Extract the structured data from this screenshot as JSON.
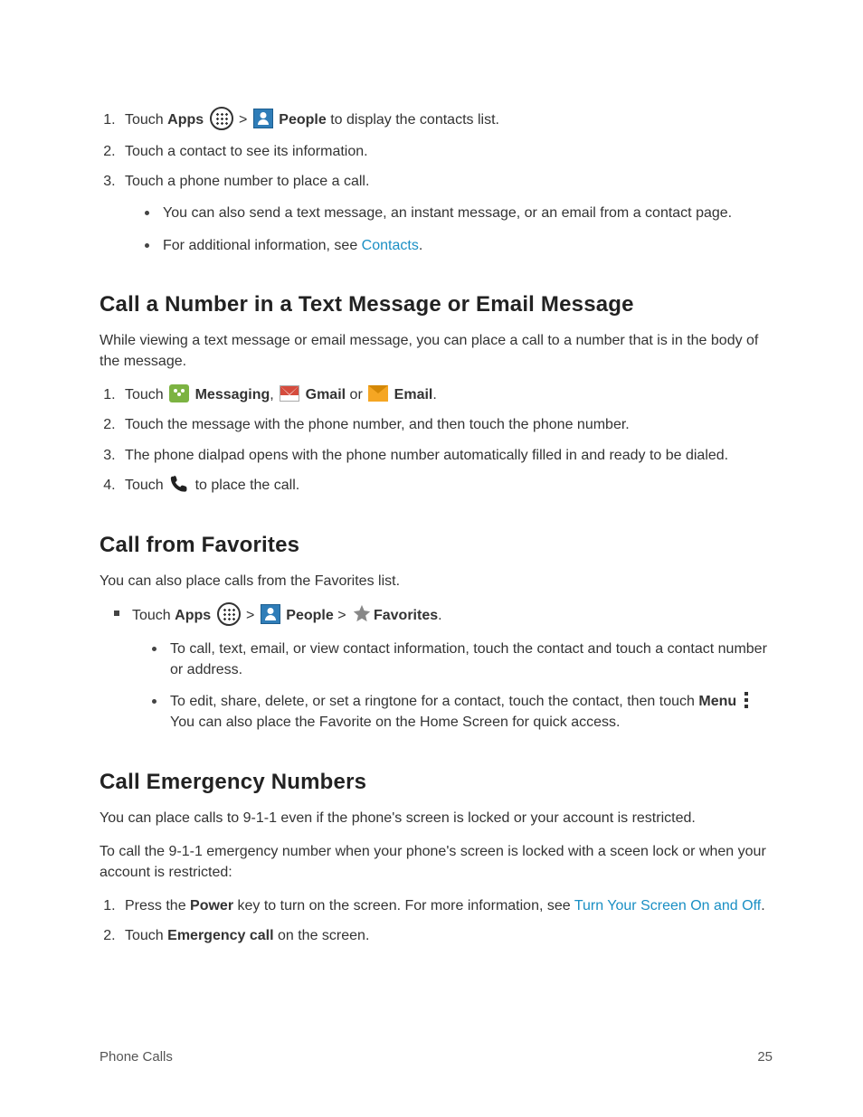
{
  "intro": {
    "step1_pre": "Touch ",
    "step1_apps": "Apps",
    "gt": " > ",
    "step1_people": "People",
    "step1_post": " to display the contacts list.",
    "step2": "Touch a contact to see its information.",
    "step3": "Touch a phone number to place a call.",
    "step3_sub1": "You can also send a text message, an instant message, or an email from a contact page.",
    "step3_sub2_pre": "For additional information, see ",
    "step3_sub2_link": "Contacts",
    "step3_sub2_post": "."
  },
  "secA": {
    "heading": "Call a Number in a Text Message or Email Message",
    "intro": "While viewing a text message or email message, you can place a call to a number that is in the body of the message.",
    "step1_pre": "Touch ",
    "step1_messaging": "Messaging",
    "step1_comma": ", ",
    "step1_gmail": "Gmail",
    "step1_or": " or ",
    "step1_email": "Email",
    "step1_post": ".",
    "step2": "Touch the message with the phone number, and then touch the phone number.",
    "step3": "The phone dialpad opens with the phone number automatically filled in and ready to be dialed.",
    "step4_pre": "Touch ",
    "step4_post": " to place the call."
  },
  "secB": {
    "heading": "Call from Favorites",
    "intro": "You can also place calls from the Favorites list.",
    "b1_pre": "Touch ",
    "b1_apps": "Apps",
    "gt": " > ",
    "b1_people": "People",
    "b1_favorites": "Favorites",
    "b1_post": ".",
    "sub1": "To call, text, email, or view contact information, touch the contact and touch a contact number or address.",
    "sub2_pre": "To edit, share, delete, or set a ringtone for a contact, touch the contact, then touch ",
    "sub2_menu": "Menu",
    "sub2_post": " You can also place the Favorite on the Home Screen for quick access."
  },
  "secC": {
    "heading": "Call Emergency Numbers",
    "p1": "You can place calls to 9-1-1 even if the phone's screen is locked or your account is restricted.",
    "p2": "To call the 9-1-1 emergency number when your phone's screen is locked with a sceen lock or when your account is restricted:",
    "step1_pre": "Press the ",
    "step1_power": "Power",
    "step1_mid": " key to turn on the screen. For more information, see ",
    "step1_link": "Turn Your Screen On and Off",
    "step1_post": ".",
    "step2_pre": "Touch ",
    "step2_bold": "Emergency call",
    "step2_post": " on the screen."
  },
  "footer": {
    "section": "Phone Calls",
    "page": "25"
  }
}
